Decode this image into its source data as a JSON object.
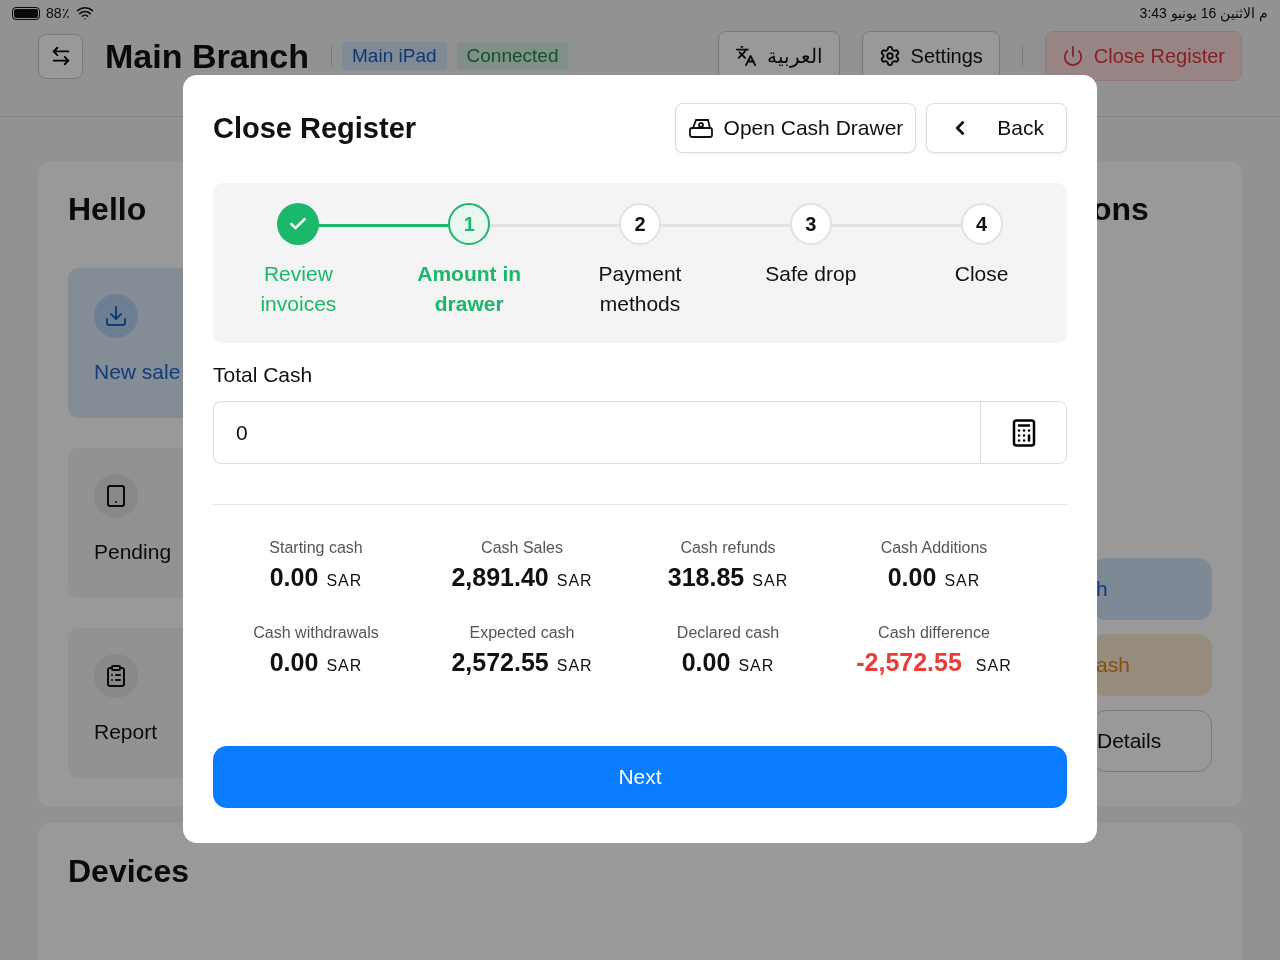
{
  "status_bar": {
    "battery": "88٪",
    "datetime": "3:43 م  الاثنين 16 يونيو"
  },
  "header": {
    "title": "Main Branch",
    "tags": [
      {
        "label": "Main iPad",
        "kind": "info"
      },
      {
        "label": "Connected",
        "kind": "success"
      }
    ],
    "language_button": "العربية",
    "settings_button": "Settings",
    "close_register_button": "Close Register"
  },
  "background": {
    "greeting": "Hello",
    "tiles": [
      {
        "label": "New sale",
        "selected": true
      },
      {
        "label": "Pending",
        "selected": false
      },
      {
        "label": "Report",
        "selected": false
      }
    ],
    "right_heading": "ons",
    "right_buttons": [
      {
        "label": "h",
        "kind": "info"
      },
      {
        "label": "ash",
        "kind": "warning"
      },
      {
        "label": "Details",
        "kind": "outline"
      }
    ],
    "devices_heading": "Devices"
  },
  "dialog": {
    "title": "Close Register",
    "open_drawer_button": "Open Cash Drawer",
    "back_button": "Back",
    "steps": [
      {
        "label": "Review invoices",
        "completed": true,
        "selected": false
      },
      {
        "marker": "1",
        "label": "Amount in drawer",
        "completed": false,
        "selected": true
      },
      {
        "marker": "2",
        "label": "Payment methods",
        "completed": false,
        "selected": false
      },
      {
        "marker": "3",
        "label": "Safe drop",
        "completed": false,
        "selected": false
      },
      {
        "marker": "4",
        "label": "Close",
        "completed": false,
        "selected": false
      }
    ],
    "total_cash": {
      "label": "Total Cash",
      "value": "0"
    },
    "stats": [
      {
        "label": "Starting cash",
        "value": "0.00",
        "currency": "SAR",
        "kind": "normal"
      },
      {
        "label": "Cash Sales",
        "value": "2,891.40",
        "currency": "SAR",
        "kind": "normal"
      },
      {
        "label": "Cash refunds",
        "value": "318.85",
        "currency": "SAR",
        "kind": "normal"
      },
      {
        "label": "Cash Additions",
        "value": "0.00",
        "currency": "SAR",
        "kind": "normal"
      },
      {
        "label": "Cash withdrawals",
        "value": "0.00",
        "currency": "SAR",
        "kind": "normal"
      },
      {
        "label": "Expected cash",
        "value": "2,572.55",
        "currency": "SAR",
        "kind": "normal"
      },
      {
        "label": "Declared cash",
        "value": "0.00",
        "currency": "SAR",
        "kind": "normal"
      },
      {
        "label": "Cash difference",
        "value": "-2,572.55",
        "currency": "SAR",
        "kind": "negative"
      }
    ],
    "next_button": "Next"
  }
}
